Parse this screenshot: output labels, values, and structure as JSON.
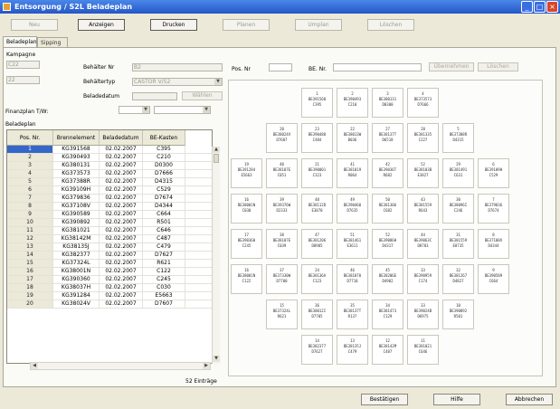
{
  "window": {
    "title": "Entsorgung / S2L  Beladeplan"
  },
  "toolbar": [
    {
      "label": "Neu",
      "active": false
    },
    {
      "label": "Anzeigen",
      "active": true
    },
    {
      "label": "Drucken",
      "active": true
    },
    {
      "label": "Planen",
      "active": false
    },
    {
      "label": "Umplan",
      "active": false
    },
    {
      "label": "Löschen",
      "active": false
    }
  ],
  "tabs": {
    "beladeplan": "Beladeplan",
    "sipping": "Sipping"
  },
  "form": {
    "kampagne_label": "Kampagne",
    "kampagne_value": "C22",
    "kampagne_value2": "22",
    "behaelter_nr_label": "Behälter Nr",
    "behaelter_nr_value": "B2",
    "behaeltertyp_label": "Behältertyp",
    "behaeltertyp_value": "CASTOR V/52",
    "beladedatum_label": "Beladedatum",
    "select_button": "Wählen",
    "finanzplan_label": "Finanzplan T/W:",
    "pos_nr_label": "Pos. Nr",
    "be_nr_label": "BE. Nr.",
    "uebernehmen_button": "Übernehmen",
    "loeschen_button": "Löschen"
  },
  "table": {
    "title": "Beladeplan",
    "headers": [
      "Pos. Nr.",
      "Brennelement",
      "Beladedatum",
      "BE-Kasten"
    ],
    "rows": [
      [
        "1",
        "KG391568",
        "02.02.2007",
        "C395"
      ],
      [
        "2",
        "KG390493",
        "02.02.2007",
        "C210"
      ],
      [
        "3",
        "KG380131",
        "02.02.2007",
        "D0300"
      ],
      [
        "4",
        "KG373573",
        "02.02.2007",
        "D7666"
      ],
      [
        "5",
        "KG37388R",
        "02.02.2007",
        "D4315"
      ],
      [
        "6",
        "KG39109H",
        "02.02.2007",
        "C529"
      ],
      [
        "7",
        "KG379836",
        "02.02.2007",
        "D7674"
      ],
      [
        "8",
        "KG37108V",
        "02.02.2007",
        "D4344"
      ],
      [
        "9",
        "KG390589",
        "02.02.2007",
        "C664"
      ],
      [
        "10",
        "KG390892",
        "02.02.2007",
        "R501"
      ],
      [
        "11",
        "KG381021",
        "02.02.2007",
        "C646"
      ],
      [
        "12",
        "KG38142M",
        "02.02.2007",
        "C487"
      ],
      [
        "13",
        "KG38135J",
        "02.02.2007",
        "C479"
      ],
      [
        "14",
        "KG382377",
        "02.02.2007",
        "D7627"
      ],
      [
        "15",
        "KG37324L",
        "02.02.2007",
        "R621"
      ],
      [
        "16",
        "KG38001N",
        "02.02.2007",
        "C122"
      ],
      [
        "17",
        "KG390360",
        "02.02.2007",
        "C245"
      ],
      [
        "18",
        "KG38037H",
        "02.02.2007",
        "C030"
      ],
      [
        "19",
        "KG391284",
        "02.02.2007",
        "E5663"
      ],
      [
        "20",
        "KG38024V",
        "02.02.2007",
        "D7607"
      ]
    ],
    "count_label": "52 Einträge"
  },
  "plan": {
    "rows": [
      {
        "start": 2,
        "cells": [
          [
            "1",
            "BE391568",
            "C395"
          ],
          [
            "2",
            "BE390493",
            "C210"
          ],
          [
            "3",
            "BE380131",
            "D0300"
          ],
          [
            "4",
            "BE373573",
            "D7666"
          ]
        ]
      },
      {
        "start": 1,
        "cells": [
          [
            "20",
            "BE38024V",
            "D7607"
          ],
          [
            "23",
            "BE390488",
            "C484"
          ],
          [
            "22",
            "BE38013W",
            "B036"
          ],
          [
            "27",
            "BE38137T",
            "D6518"
          ],
          [
            "28",
            "BE381335",
            "C227"
          ],
          [
            "5",
            "BE37388R",
            "D4315"
          ]
        ]
      },
      {
        "start": 0,
        "cells": [
          [
            "19",
            "BE391284",
            "E5663"
          ],
          [
            "40",
            "BE38107E",
            "C051"
          ],
          [
            "21",
            "BE390001",
            "C323"
          ],
          [
            "41",
            "BE381019",
            "R064"
          ],
          [
            "42",
            "BE39036T",
            "R682"
          ],
          [
            "52",
            "BE38103B",
            "E3827"
          ],
          [
            "29",
            "BE381491",
            "C631"
          ],
          [
            "6",
            "BE39109H",
            "C529"
          ]
        ]
      },
      {
        "start": 0,
        "cells": [
          [
            "16",
            "BE38001N",
            "C030"
          ],
          [
            "39",
            "BE39376W",
            "D2333"
          ],
          [
            "48",
            "BE38112D",
            "E3070"
          ],
          [
            "49",
            "BE390460",
            "D7635"
          ],
          [
            "50",
            "BE381306",
            "C682"
          ],
          [
            "43",
            "BE381559",
            "R643"
          ],
          [
            "30",
            "BE38096I",
            "C246"
          ],
          [
            "7",
            "BE379836",
            "D7674"
          ]
        ]
      },
      {
        "start": 0,
        "cells": [
          [
            "17",
            "BE390360",
            "C245"
          ],
          [
            "38",
            "BE38107E",
            "C039"
          ],
          [
            "47",
            "BE381206",
            "D8985"
          ],
          [
            "51",
            "BE381461",
            "E3611"
          ],
          [
            "52",
            "BE39086H",
            "D4317"
          ],
          [
            "44",
            "BE39063C",
            "D8783"
          ],
          [
            "31",
            "BE381559",
            "E8735"
          ],
          [
            "8",
            "BE37108V",
            "D4344"
          ]
        ]
      },
      {
        "start": 0,
        "cells": [
          [
            "16",
            "BE38001N",
            "C122"
          ],
          [
            "37",
            "BE37330W",
            "D7700"
          ],
          [
            "24",
            "BE38136A",
            "C123"
          ],
          [
            "46",
            "BE381070",
            "D7718"
          ],
          [
            "45",
            "BE38206E",
            "D4902"
          ],
          [
            "33",
            "BE390959",
            "C174"
          ],
          [
            "32",
            "BE381267",
            "D4827"
          ],
          [
            "9",
            "BE390589",
            "C664"
          ]
        ]
      },
      {
        "start": 1,
        "cells": [
          [
            "15",
            "BE37324L",
            "R621"
          ],
          [
            "36",
            "BE38012I",
            "D7705"
          ],
          [
            "35",
            "BE38137T",
            "R137"
          ],
          [
            "34",
            "BE381473",
            "C129"
          ],
          [
            "33",
            "BE39024B",
            "D6975"
          ],
          [
            "10",
            "BE390892",
            "R501"
          ]
        ]
      },
      {
        "start": 2,
        "cells": [
          [
            "14",
            "BE382377",
            "D7627"
          ],
          [
            "13",
            "BE38135J",
            "C479"
          ],
          [
            "12",
            "BE38142M",
            "C487"
          ],
          [
            "11",
            "BE381021",
            "C646"
          ]
        ]
      }
    ]
  },
  "bottom": {
    "bestaetigen": "Bestätigen",
    "hilfe": "Hilfe",
    "abbrechen": "Abbrechen"
  }
}
